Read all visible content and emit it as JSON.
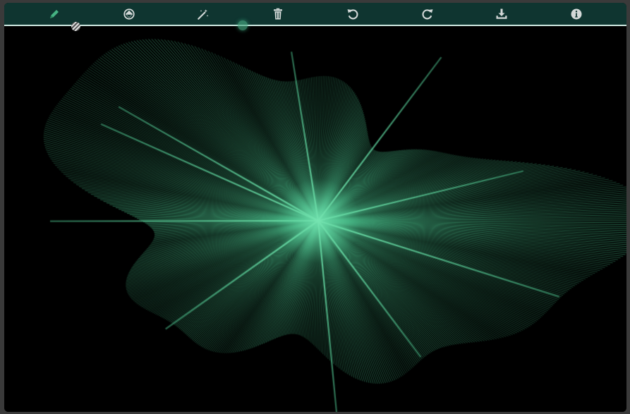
{
  "toolbar": {
    "tools": [
      {
        "name": "pencil-icon",
        "active": true
      },
      {
        "name": "fill-icon",
        "active": false
      },
      {
        "name": "magic-wand-icon",
        "active": false
      },
      {
        "name": "trash-icon",
        "active": false
      },
      {
        "name": "undo-icon",
        "active": false
      },
      {
        "name": "redo-icon",
        "active": false
      },
      {
        "name": "download-icon",
        "active": false
      },
      {
        "name": "info-icon",
        "active": false
      }
    ]
  },
  "colors": {
    "toolbar_bg": "#0f3530",
    "icon": "#d4d9d8",
    "icon_active": "#46b383",
    "stroke": "#4bbf8c",
    "canvas_bg": "#000000"
  }
}
